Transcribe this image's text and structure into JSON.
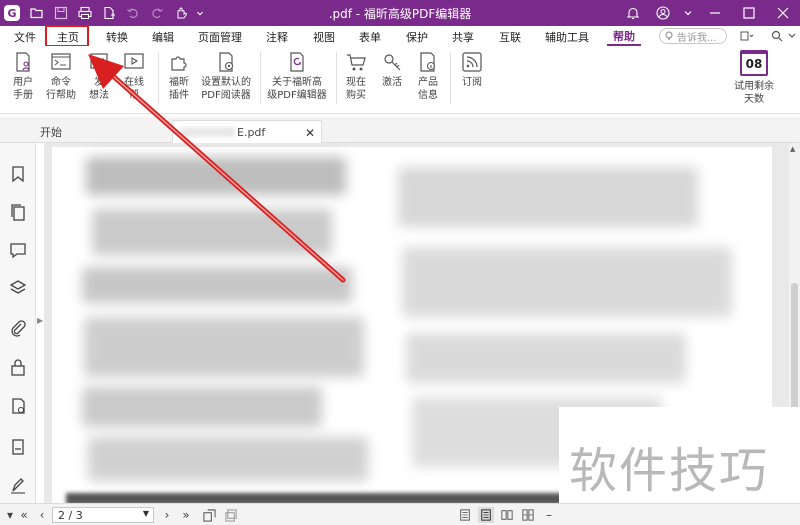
{
  "title_bar": {
    "logo_letter": "G",
    "title": ".pdf - 福昕高级PDF编辑器"
  },
  "menu": {
    "items": [
      {
        "label": "文件"
      },
      {
        "label": "主页"
      },
      {
        "label": "转换"
      },
      {
        "label": "编辑"
      },
      {
        "label": "页面管理"
      },
      {
        "label": "注释"
      },
      {
        "label": "视图"
      },
      {
        "label": "表单"
      },
      {
        "label": "保护"
      },
      {
        "label": "共享"
      },
      {
        "label": "互联"
      },
      {
        "label": "辅助工具"
      },
      {
        "label": "帮助"
      }
    ],
    "search_placeholder": "告诉我..."
  },
  "ribbon": {
    "buttons": [
      {
        "label": "用户\n手册",
        "icon": "user-manual-icon"
      },
      {
        "label": "命令\n行帮助",
        "icon": "command-line-icon"
      },
      {
        "label": "发\n想法",
        "icon": "feedback-icon"
      },
      {
        "label": "在线\n帮",
        "icon": "video-icon"
      },
      {
        "label": "福昕\n插件",
        "icon": "plugin-icon"
      },
      {
        "label": "设置默认的\nPDF阅读器",
        "icon": "default-reader-icon"
      },
      {
        "label": "关于福昕高\n级PDF编辑器",
        "icon": "about-icon"
      },
      {
        "label": "现在\n购买",
        "icon": "cart-icon"
      },
      {
        "label": "激活",
        "icon": "activate-icon"
      },
      {
        "label": "产品\n信息",
        "icon": "product-info-icon"
      },
      {
        "label": "订阅",
        "icon": "rss-icon"
      }
    ],
    "trial": {
      "days": "08",
      "label": "试用剩余\n天数"
    }
  },
  "tabs": {
    "start": "开始",
    "doc": "E.pdf"
  },
  "status": {
    "page": "2 / 3"
  },
  "watermark": "软件技巧",
  "colors": {
    "brand": "#7a2a8a",
    "annotation": "#d82020"
  }
}
